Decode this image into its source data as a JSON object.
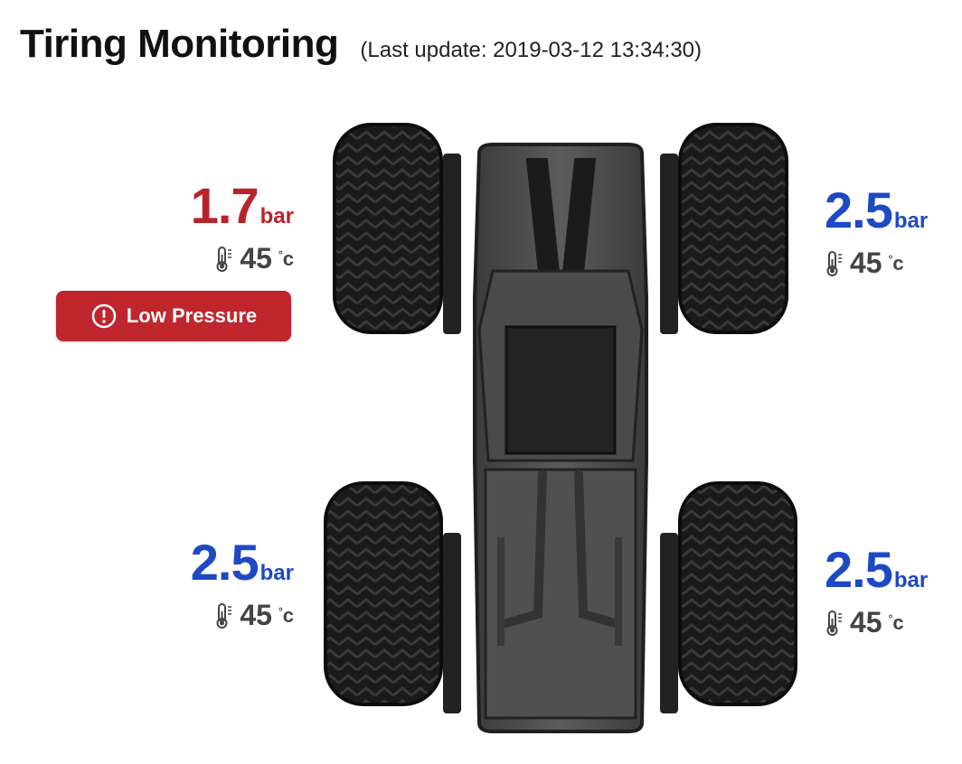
{
  "header": {
    "title": "Tiring Monitoring",
    "last_update": "(Last update: 2019-03-12 13:34:30)"
  },
  "tires": {
    "front_left": {
      "pressure": "1.7",
      "unit": "bar",
      "temp": "45",
      "temp_unit": "c",
      "status": "alert"
    },
    "front_right": {
      "pressure": "2.5",
      "unit": "bar",
      "temp": "45",
      "temp_unit": "c",
      "status": "normal"
    },
    "rear_left": {
      "pressure": "2.5",
      "unit": "bar",
      "temp": "45",
      "temp_unit": "c",
      "status": "normal"
    },
    "rear_right": {
      "pressure": "2.5",
      "unit": "bar",
      "temp": "45",
      "temp_unit": "c",
      "status": "normal"
    }
  },
  "alert": {
    "label": "Low Pressure",
    "icon": "alert-circle-icon"
  },
  "colors": {
    "normal": "#1d49c4",
    "alert": "#b8232a",
    "badge": "#c0262d"
  },
  "icons": {
    "temperature": "thermometer-icon",
    "vehicle": "vehicle-top-view"
  }
}
